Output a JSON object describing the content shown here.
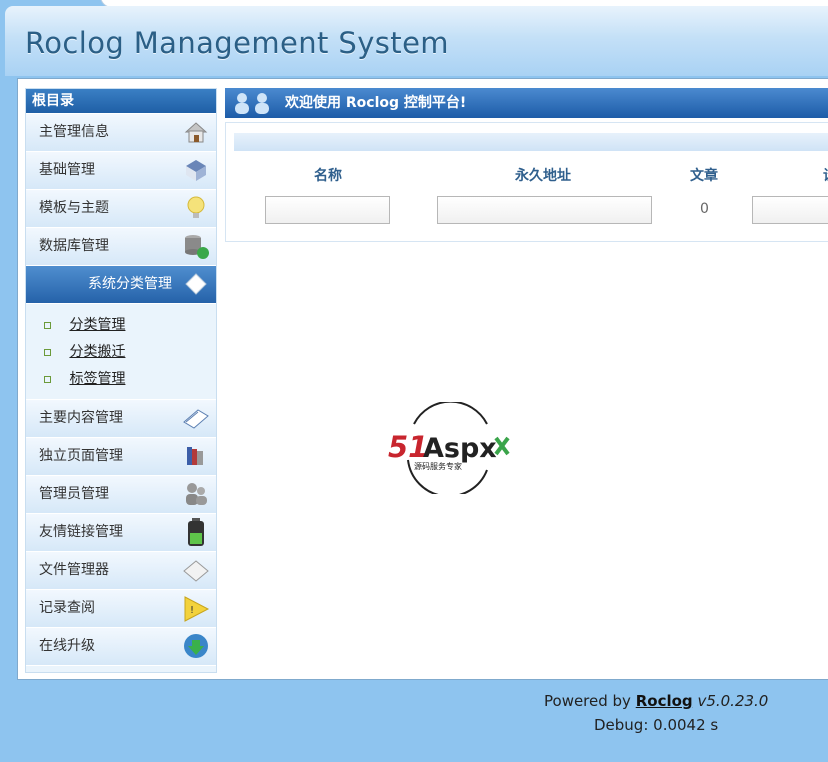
{
  "header": {
    "title": "Roclog Management System"
  },
  "sidebar": {
    "heading": "根目录",
    "items": [
      {
        "label": "主管理信息",
        "icon": "house-icon"
      },
      {
        "label": "基础管理",
        "icon": "cube-icon"
      },
      {
        "label": "模板与主题",
        "icon": "bulb-icon"
      },
      {
        "label": "数据库管理",
        "icon": "database-refresh-icon"
      },
      {
        "label": "系统分类管理",
        "icon": "diamond-icon"
      },
      {
        "label": "主要内容管理",
        "icon": "book-icon"
      },
      {
        "label": "独立页面管理",
        "icon": "books-icon"
      },
      {
        "label": "管理员管理",
        "icon": "users-icon"
      },
      {
        "label": "友情链接管理",
        "icon": "battery-icon"
      },
      {
        "label": "文件管理器",
        "icon": "folder-icon"
      },
      {
        "label": "记录查阅",
        "icon": "warning-icon"
      },
      {
        "label": "在线升级",
        "icon": "globe-download-icon"
      }
    ],
    "sub_items": [
      {
        "label": "分类管理"
      },
      {
        "label": "分类搬迁"
      },
      {
        "label": "标签管理"
      }
    ]
  },
  "main": {
    "welcome": "欢迎使用 Roclog 控制平台!",
    "columns": [
      "名称",
      "永久地址",
      "文章",
      "设"
    ],
    "row": {
      "name": "",
      "permalink": "",
      "count": "0",
      "extra": ""
    }
  },
  "logo": {
    "brand": "51Aspx",
    "tagline": "源码服务专家"
  },
  "footer": {
    "powered_by": "Powered by",
    "brand": "Roclog",
    "version": "v5.0.23.0",
    "debug": "Debug: 0.0042 s"
  }
}
